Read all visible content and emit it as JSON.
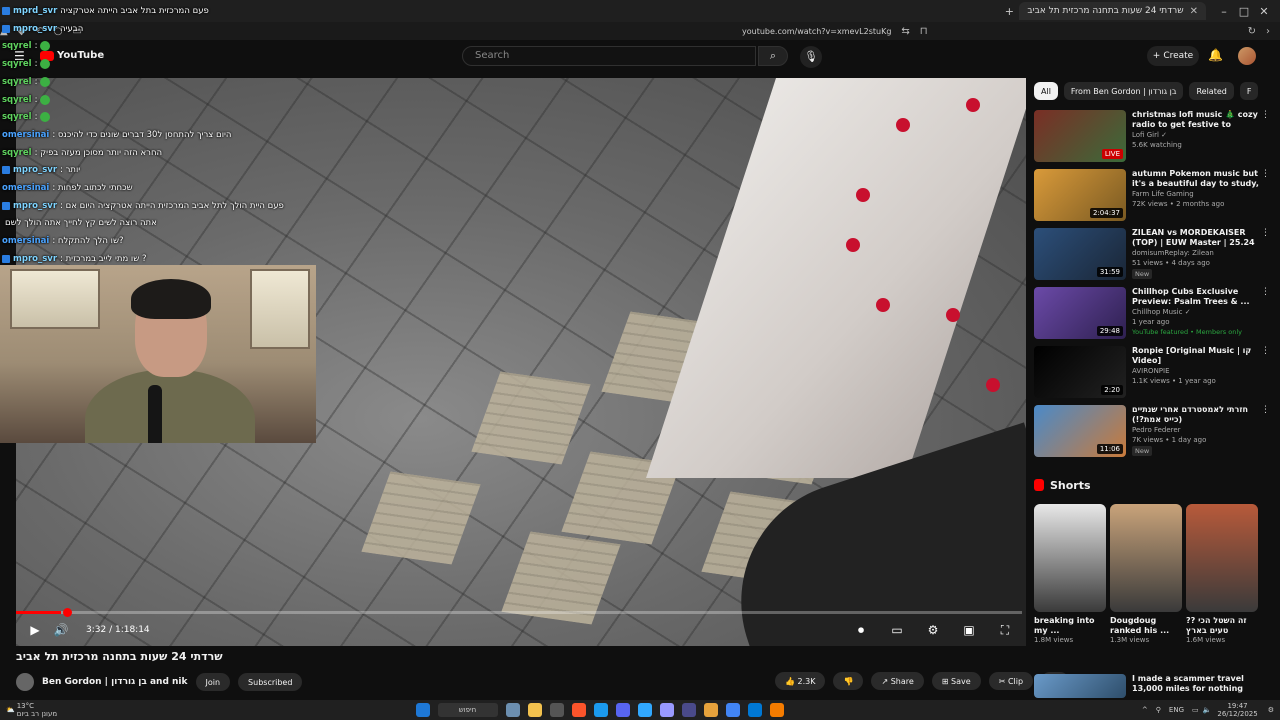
{
  "browser": {
    "tab_title": "שרדתי 24 שעות בתחנה מרכזית תל אביב",
    "url": "youtube.com/watch?v=xmevL2stuKg"
  },
  "youtube": {
    "logo": "YouTube",
    "search_placeholder": "Search",
    "create_label": "Create"
  },
  "chat": [
    {
      "user": "mprd_svr",
      "msg": "פעם המרכזית בתל אביב הייתה אטרקציה",
      "badge": true
    },
    {
      "user": "mpro_svr",
      "msg": "הבעיה",
      "badge": true
    },
    {
      "user": "sqyrel",
      "msg": ":",
      "badge": false
    },
    {
      "user": "sqyrel",
      "msg": ":",
      "badge": false
    },
    {
      "user": "sqyrel",
      "msg": ":",
      "badge": false
    },
    {
      "user": "sqyrel",
      "msg": ":",
      "badge": false
    },
    {
      "user": "sqyrel",
      "msg": ":",
      "badge": false
    },
    {
      "user": "omersinai",
      "msg": ": היום צריך להתחסן ל30 דברים שונים כדי להיכנס",
      "badge": false
    },
    {
      "user": "sqyrel",
      "msg": ": החרא הזה יותר מסוכן מעזה בפיק",
      "badge": false
    },
    {
      "user": "mpro_svr",
      "msg": ": יותר",
      "badge": true
    },
    {
      "user": "omersinai",
      "msg": ": שכחתי לכתוב לפחות",
      "badge": false
    },
    {
      "user": "mpro_svr",
      "msg": ": פעם היית הולך לתל אביב המרכזית הייתה אטרקציה היום אם",
      "badge": true
    },
    {
      "user": "",
      "msg": "אתה רוצה לשים קץ לחייך אתה הולך לשם",
      "badge": false
    },
    {
      "user": "omersinai",
      "msg": ": שו הלך להתקלח?",
      "badge": false
    },
    {
      "user": "mpro_svr",
      "msg": ": שו מתי לייב במרכזית ?",
      "badge": true
    }
  ],
  "player": {
    "time": "3:32 / 1:18:14",
    "progress": 0.045
  },
  "video": {
    "title": "שרדתי 24 שעות בתחנה מרכזית תל אביב",
    "channel": "Ben Gordon | בן גורדון and nik",
    "join": "Join",
    "subscribed": "Subscribed",
    "likes": "2.3K",
    "share": "Share",
    "save": "Save",
    "clip": "Clip"
  },
  "chips": [
    "All",
    "From Ben Gordon | בן גורדון",
    "Related",
    "F"
  ],
  "recommendations": [
    {
      "title": "christmas lofi music 🎄 cozy radio to get festive to",
      "channel": "Lofi Girl ✓",
      "stats": "5.6K watching",
      "duration": "LIVE",
      "live": true,
      "color1": "#7a2e25",
      "color2": "#3b6b3a",
      "extra": ""
    },
    {
      "title": "autumn Pokemon music but it's a beautiful day to study, work, ...",
      "channel": "Farm Life Gaming",
      "stats": "72K views • 2 months ago",
      "duration": "2:04:37",
      "live": false,
      "color1": "#d99a3a",
      "color2": "#7a5a22",
      "extra": ""
    },
    {
      "title": "ZILEAN vs MORDEKAISER (TOP) | EUW Master | 25.24",
      "channel": "domisumReplay: Zilean",
      "stats": "51 views • 4 days ago",
      "duration": "31:59",
      "live": false,
      "color1": "#2c4f7a",
      "color2": "#1a2636",
      "extra": "New"
    },
    {
      "title": "Chillhop Cubs Exclusive Preview: Psalm Trees & ...",
      "channel": "Chillhop Music ✓",
      "stats": "1 year ago",
      "duration": "29:48",
      "live": false,
      "color1": "#6b4aa8",
      "color2": "#2e2050",
      "extra": "YouTube featured • Members only"
    },
    {
      "title": "Ronpie [Original Music | קו Video]",
      "channel": "AVIRONPIE",
      "stats": "1.1K views • 1 year ago",
      "duration": "2:20",
      "live": false,
      "color1": "#000000",
      "color2": "#222222",
      "extra": ""
    },
    {
      "title": "חזרתי לאמסטרדם אחרי שנתיים (כייס אמת?!)",
      "channel": "Pedro Federer",
      "stats": "7K views • 1 day ago",
      "duration": "11:06",
      "live": false,
      "color1": "#4a8ac9",
      "color2": "#c97a3a",
      "extra": "New"
    }
  ],
  "shorts": {
    "heading": "Shorts",
    "items": [
      {
        "title": "breaking into my ...",
        "views": "1.8M views",
        "color": "#e8e8e8"
      },
      {
        "title": "Dougdoug ranked his ...",
        "views": "1.3M views",
        "color": "#c9a37a"
      },
      {
        "title": "זה השטל הכי ??טעים בארץ",
        "views": "1.6M views",
        "color": "#b85a3a"
      }
    ]
  },
  "last_rec": {
    "title": "I made a scammer travel 13,000 miles for nothing"
  },
  "taskbar": {
    "time": "19:47",
    "date": "26/12/2025",
    "lang": "ENG",
    "search": "חיפוש",
    "weather": "13°C",
    "weather_desc": "מעונן רב ביום"
  }
}
